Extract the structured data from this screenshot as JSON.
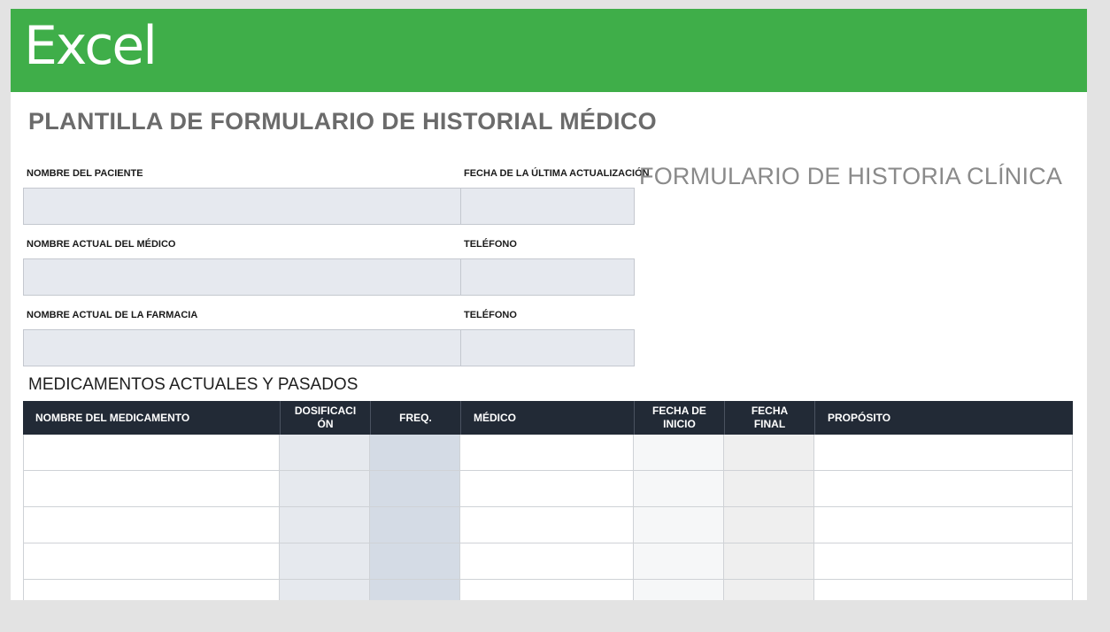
{
  "app": {
    "name": "Excel",
    "brand_color": "#3fae49"
  },
  "document": {
    "title": "PLANTILLA DE FORMULARIO DE HISTORIAL MÉDICO",
    "overlay_title": "FORMULARIO DE HISTORIA CLÍNICA"
  },
  "form": {
    "patient_name_label": "NOMBRE DEL PACIENTE",
    "last_update_label": "FECHA DE LA ÚLTIMA ACTUALIZACIÓN",
    "doctor_name_label": "NOMBRE ACTUAL DEL MÉDICO",
    "doctor_phone_label": "TELÉFONO",
    "pharmacy_name_label": "NOMBRE ACTUAL DE LA FARMACIA",
    "pharmacy_phone_label": "TELÉFONO"
  },
  "medications": {
    "section_title": "MEDICAMENTOS ACTUALES Y PASADOS",
    "columns": [
      "NOMBRE DEL MEDICAMENTO",
      "DOSIFICACI ÓN",
      "FREQ.",
      "MÉDICO",
      "FECHA DE INICIO",
      "FECHA FINAL",
      "PROPÓSITO"
    ],
    "column_lines": [
      [
        "NOMBRE DEL MEDICAMENTO"
      ],
      [
        "DOSIFICACI",
        "ÓN"
      ],
      [
        "FREQ."
      ],
      [
        "MÉDICO"
      ],
      [
        "FECHA DE",
        "INICIO"
      ],
      [
        "FECHA",
        "FINAL"
      ],
      [
        "PROPÓSITO"
      ]
    ],
    "column_fill_colors": [
      "#ffffff",
      "#e6e9ee",
      "#d4dbe5",
      "#ffffff",
      "#f6f7f8",
      "#efefef",
      "#ffffff"
    ],
    "header_color": "#222a36",
    "visible_rows": 5
  }
}
